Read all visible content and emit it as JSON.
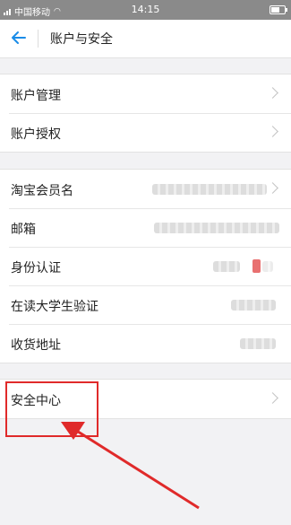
{
  "status_bar": {
    "carrier": "中国移动",
    "time": "14:15"
  },
  "nav": {
    "title": "账户与安全"
  },
  "group1": [
    {
      "label": "账户管理"
    },
    {
      "label": "账户授权"
    }
  ],
  "group2": [
    {
      "label": "淘宝会员名"
    },
    {
      "label": "邮箱"
    },
    {
      "label": "身份认证"
    },
    {
      "label": "在读大学生验证"
    },
    {
      "label": "收货地址"
    }
  ],
  "group3": [
    {
      "label": "安全中心"
    }
  ],
  "colors": {
    "accent": "#1a8ce8",
    "annotation": "#e02a2a"
  },
  "icons": {
    "back": "back-arrow-icon",
    "row_arrow": "chevron-right-icon"
  }
}
